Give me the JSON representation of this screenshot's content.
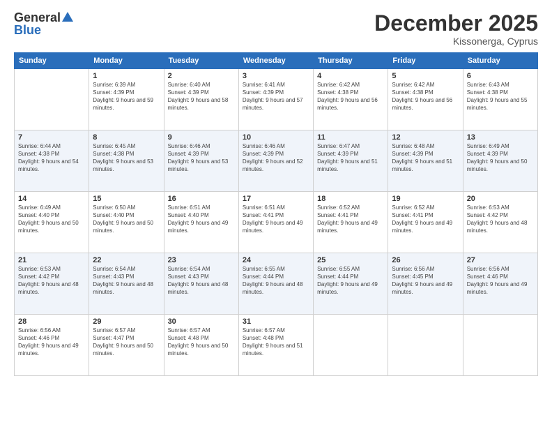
{
  "logo": {
    "general": "General",
    "blue": "Blue"
  },
  "header": {
    "month": "December 2025",
    "location": "Kissonerga, Cyprus"
  },
  "weekdays": [
    "Sunday",
    "Monday",
    "Tuesday",
    "Wednesday",
    "Thursday",
    "Friday",
    "Saturday"
  ],
  "weeks": [
    [
      {
        "day": "",
        "empty": true
      },
      {
        "day": "1",
        "sunrise": "6:39 AM",
        "sunset": "4:39 PM",
        "daylight": "9 hours and 59 minutes."
      },
      {
        "day": "2",
        "sunrise": "6:40 AM",
        "sunset": "4:39 PM",
        "daylight": "9 hours and 58 minutes."
      },
      {
        "day": "3",
        "sunrise": "6:41 AM",
        "sunset": "4:39 PM",
        "daylight": "9 hours and 57 minutes."
      },
      {
        "day": "4",
        "sunrise": "6:42 AM",
        "sunset": "4:38 PM",
        "daylight": "9 hours and 56 minutes."
      },
      {
        "day": "5",
        "sunrise": "6:42 AM",
        "sunset": "4:38 PM",
        "daylight": "9 hours and 56 minutes."
      },
      {
        "day": "6",
        "sunrise": "6:43 AM",
        "sunset": "4:38 PM",
        "daylight": "9 hours and 55 minutes."
      }
    ],
    [
      {
        "day": "7",
        "sunrise": "6:44 AM",
        "sunset": "4:38 PM",
        "daylight": "9 hours and 54 minutes."
      },
      {
        "day": "8",
        "sunrise": "6:45 AM",
        "sunset": "4:38 PM",
        "daylight": "9 hours and 53 minutes."
      },
      {
        "day": "9",
        "sunrise": "6:46 AM",
        "sunset": "4:39 PM",
        "daylight": "9 hours and 53 minutes."
      },
      {
        "day": "10",
        "sunrise": "6:46 AM",
        "sunset": "4:39 PM",
        "daylight": "9 hours and 52 minutes."
      },
      {
        "day": "11",
        "sunrise": "6:47 AM",
        "sunset": "4:39 PM",
        "daylight": "9 hours and 51 minutes."
      },
      {
        "day": "12",
        "sunrise": "6:48 AM",
        "sunset": "4:39 PM",
        "daylight": "9 hours and 51 minutes."
      },
      {
        "day": "13",
        "sunrise": "6:49 AM",
        "sunset": "4:39 PM",
        "daylight": "9 hours and 50 minutes."
      }
    ],
    [
      {
        "day": "14",
        "sunrise": "6:49 AM",
        "sunset": "4:40 PM",
        "daylight": "9 hours and 50 minutes."
      },
      {
        "day": "15",
        "sunrise": "6:50 AM",
        "sunset": "4:40 PM",
        "daylight": "9 hours and 50 minutes."
      },
      {
        "day": "16",
        "sunrise": "6:51 AM",
        "sunset": "4:40 PM",
        "daylight": "9 hours and 49 minutes."
      },
      {
        "day": "17",
        "sunrise": "6:51 AM",
        "sunset": "4:41 PM",
        "daylight": "9 hours and 49 minutes."
      },
      {
        "day": "18",
        "sunrise": "6:52 AM",
        "sunset": "4:41 PM",
        "daylight": "9 hours and 49 minutes."
      },
      {
        "day": "19",
        "sunrise": "6:52 AM",
        "sunset": "4:41 PM",
        "daylight": "9 hours and 49 minutes."
      },
      {
        "day": "20",
        "sunrise": "6:53 AM",
        "sunset": "4:42 PM",
        "daylight": "9 hours and 48 minutes."
      }
    ],
    [
      {
        "day": "21",
        "sunrise": "6:53 AM",
        "sunset": "4:42 PM",
        "daylight": "9 hours and 48 minutes."
      },
      {
        "day": "22",
        "sunrise": "6:54 AM",
        "sunset": "4:43 PM",
        "daylight": "9 hours and 48 minutes."
      },
      {
        "day": "23",
        "sunrise": "6:54 AM",
        "sunset": "4:43 PM",
        "daylight": "9 hours and 48 minutes."
      },
      {
        "day": "24",
        "sunrise": "6:55 AM",
        "sunset": "4:44 PM",
        "daylight": "9 hours and 48 minutes."
      },
      {
        "day": "25",
        "sunrise": "6:55 AM",
        "sunset": "4:44 PM",
        "daylight": "9 hours and 49 minutes."
      },
      {
        "day": "26",
        "sunrise": "6:56 AM",
        "sunset": "4:45 PM",
        "daylight": "9 hours and 49 minutes."
      },
      {
        "day": "27",
        "sunrise": "6:56 AM",
        "sunset": "4:46 PM",
        "daylight": "9 hours and 49 minutes."
      }
    ],
    [
      {
        "day": "28",
        "sunrise": "6:56 AM",
        "sunset": "4:46 PM",
        "daylight": "9 hours and 49 minutes."
      },
      {
        "day": "29",
        "sunrise": "6:57 AM",
        "sunset": "4:47 PM",
        "daylight": "9 hours and 50 minutes."
      },
      {
        "day": "30",
        "sunrise": "6:57 AM",
        "sunset": "4:48 PM",
        "daylight": "9 hours and 50 minutes."
      },
      {
        "day": "31",
        "sunrise": "6:57 AM",
        "sunset": "4:48 PM",
        "daylight": "9 hours and 51 minutes."
      },
      {
        "day": "",
        "empty": true
      },
      {
        "day": "",
        "empty": true
      },
      {
        "day": "",
        "empty": true
      }
    ]
  ],
  "labels": {
    "sunrise": "Sunrise:",
    "sunset": "Sunset:",
    "daylight": "Daylight:"
  }
}
